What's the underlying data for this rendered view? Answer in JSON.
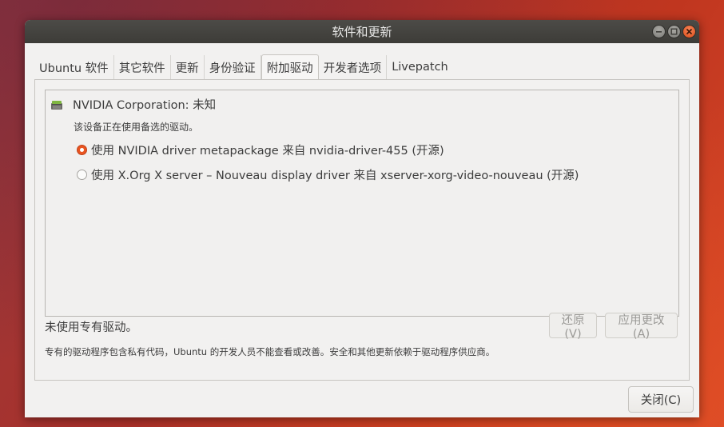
{
  "window": {
    "title": "软件和更新"
  },
  "tabs": [
    {
      "label": "Ubuntu 软件",
      "active": false
    },
    {
      "label": "其它软件",
      "active": false
    },
    {
      "label": "更新",
      "active": false
    },
    {
      "label": "身份验证",
      "active": false
    },
    {
      "label": "附加驱动",
      "active": true
    },
    {
      "label": "开发者选项",
      "active": false
    },
    {
      "label": "Livepatch",
      "active": false
    }
  ],
  "device": {
    "icon": "chip-icon",
    "name": "NVIDIA Corporation: 未知",
    "status": "该设备正在使用备选的驱动。",
    "drivers": [
      {
        "label": "使用 NVIDIA driver metapackage 来自 nvidia-driver-455 (开源)",
        "selected": true
      },
      {
        "label": "使用 X.Org X server – Nouveau display driver 来自 xserver-xorg-video-nouveau (开源)",
        "selected": false
      }
    ]
  },
  "status_text": "未使用专有驱动。",
  "buttons": {
    "revert": "还原(V)",
    "apply": "应用更改(A)",
    "close": "关闭(C)"
  },
  "footnote": "专有的驱动程序包含私有代码，Ubuntu 的开发人员不能查看或改善。安全和其他更新依赖于驱动程序供应商。",
  "colors": {
    "accent": "#e95420",
    "titlebar": "#3d3c38",
    "window_bg": "#f2f1f0"
  }
}
